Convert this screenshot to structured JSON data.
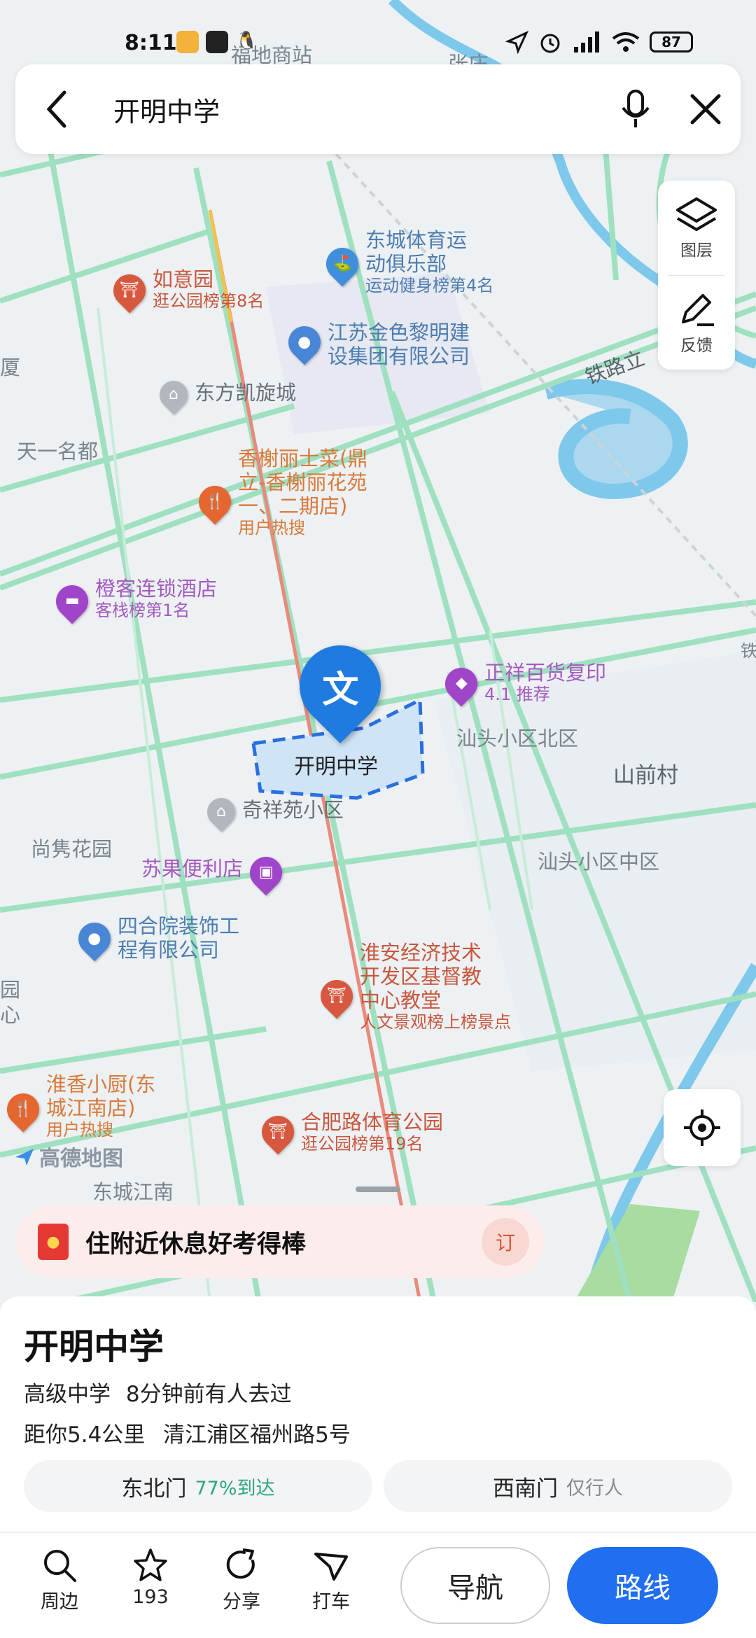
{
  "status_bar": {
    "time": "8:11",
    "battery": "87"
  },
  "search": {
    "query": "开明中学"
  },
  "tools": {
    "layers_label": "图层",
    "feedback_label": "反馈"
  },
  "map": {
    "selected": {
      "name": "开明中学",
      "pin_glyph": "文"
    },
    "pois": [
      {
        "name": "东城体育运\n动俱乐部",
        "sub": "运动健身榜第4名"
      },
      {
        "name": "如意园",
        "sub": "逛公园榜第8名"
      },
      {
        "name": "江苏金色黎明建\n设集团有限公司",
        "sub": ""
      },
      {
        "name": "东方凯旋城",
        "sub": ""
      },
      {
        "name": "香榭丽士菜(鼎\n立-香榭丽花苑\n一、二期店)",
        "sub": "用户热搜"
      },
      {
        "name": "橙客连锁酒店",
        "sub": "客栈榜第1名"
      },
      {
        "name": "正祥百货复印",
        "sub": "4.1 推荐"
      },
      {
        "name": "奇祥苑小区",
        "sub": ""
      },
      {
        "name": "苏果便利店",
        "sub": ""
      },
      {
        "name": "四合院装饰工\n程有限公司",
        "sub": ""
      },
      {
        "name": "淮安经济技术\n开发区基督教\n中心教堂",
        "sub": "人文景观榜上榜景点"
      },
      {
        "name": "淮香小厨(东\n城江南店)",
        "sub": "用户热搜"
      },
      {
        "name": "合肥路体育公园",
        "sub": "逛公园榜第19名"
      }
    ],
    "labels": {
      "tianyi": "天一名都",
      "shantou_north": "汕头小区北区",
      "shanqian": "山前村",
      "shantou_mid": "汕头小区中区",
      "shangjun": "尚隽花园",
      "dongcheng_jiangnan": "东城江南",
      "railway": "铁路立",
      "xia": "厦",
      "tie": "铁",
      "yuan_xin": "园\n心",
      "zhang": "张庄",
      "fudi": "福地商站",
      "brand": "高德地图"
    }
  },
  "promo": {
    "text": "住附近休息好考得棒",
    "action": "订"
  },
  "place": {
    "name": "开明中学",
    "category": "高级中学",
    "visited": "8分钟前有人去过",
    "distance": "距你5.4公里",
    "address": "清江浦区福州路5号",
    "gates": [
      {
        "name": "东北门",
        "note": "77%到达"
      },
      {
        "name": "西南门",
        "note": "仅行人"
      }
    ]
  },
  "bottom_bar": {
    "nearby": "周边",
    "favorites_count": "193",
    "share": "分享",
    "taxi": "打车",
    "navigate": "导航",
    "route": "路线"
  }
}
